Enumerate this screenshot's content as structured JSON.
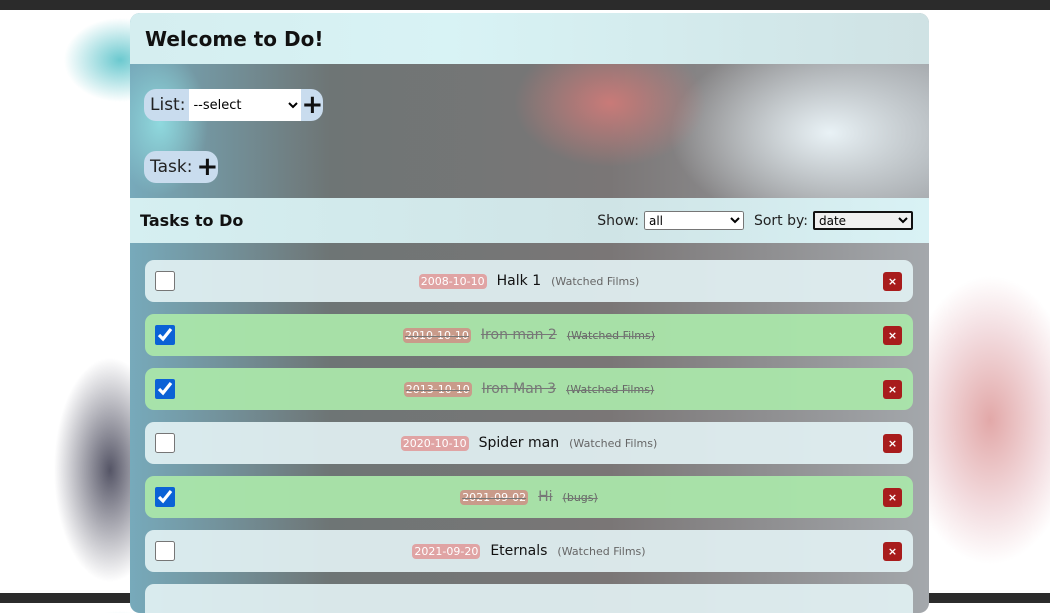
{
  "header": {
    "title": "Welcome to Do!"
  },
  "list": {
    "label": "List:",
    "selected": "--select",
    "add": "+"
  },
  "task": {
    "label": "Task:",
    "add": "+"
  },
  "tasks_bar": {
    "title": "Tasks to Do",
    "show_label": "Show:",
    "show_value": "all",
    "sort_label": "Sort by:",
    "sort_value": "date"
  },
  "tasks": [
    {
      "date": "2008-10-10",
      "name": "Halk 1",
      "list": "(Watched Films)",
      "done": false
    },
    {
      "date": "2010-10-10",
      "name": "Iron man 2",
      "list": "(Watched Films)",
      "done": true
    },
    {
      "date": "2013-10-10",
      "name": "Iron Man 3",
      "list": "(Watched Films)",
      "done": true
    },
    {
      "date": "2020-10-10",
      "name": "Spider man",
      "list": "(Watched Films)",
      "done": false
    },
    {
      "date": "2021-09-02",
      "name": "Hi",
      "list": "(bugs)",
      "done": true
    },
    {
      "date": "2021-09-20",
      "name": "Eternals",
      "list": "(Watched Films)",
      "done": false
    }
  ],
  "delete_label": "×"
}
